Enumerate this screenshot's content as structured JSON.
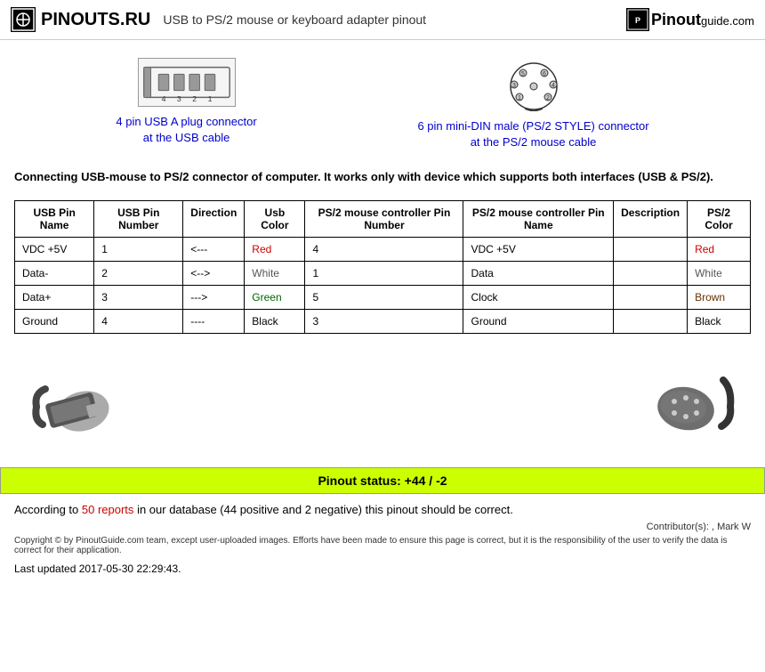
{
  "header": {
    "site_name": "PINOUTS.RU",
    "page_title": "USB to PS/2 mouse or keyboard adapter pinout",
    "guide_name": "Pinout",
    "guide_suffix": "guide.com"
  },
  "connectors": [
    {
      "id": "usb",
      "link_text": "4 pin USB A plug connector\nat the USB cable"
    },
    {
      "id": "ps2",
      "link_text": "6 pin mini-DIN male (PS/2 STYLE) connector\nat the PS/2 mouse cable"
    }
  ],
  "description": "Connecting USB-mouse to PS/2 connector of computer. It works only with device which supports both interfaces (USB & PS/2).",
  "table": {
    "headers": [
      "USB Pin Name",
      "USB Pin Number",
      "Direction",
      "Usb Color",
      "PS/2 mouse controller Pin Number",
      "PS/2 mouse controller Pin Name",
      "Description",
      "PS/2 Color"
    ],
    "rows": [
      {
        "usb_pin_name": "VDC +5V",
        "usb_pin_num": "1",
        "direction": "<---",
        "usb_color": "Red",
        "ps2_pin_num": "4",
        "ps2_pin_name": "VDC +5V",
        "description": "",
        "ps2_color": "Red"
      },
      {
        "usb_pin_name": "Data-",
        "usb_pin_num": "2",
        "direction": "<-->",
        "usb_color": "White",
        "ps2_pin_num": "1",
        "ps2_pin_name": "Data",
        "description": "",
        "ps2_color": "White"
      },
      {
        "usb_pin_name": "Data+",
        "usb_pin_num": "3",
        "direction": "--->",
        "usb_color": "Green",
        "ps2_pin_num": "5",
        "ps2_pin_name": "Clock",
        "description": "",
        "ps2_color": "Brown"
      },
      {
        "usb_pin_name": "Ground",
        "usb_pin_num": "4",
        "direction": "----",
        "usb_color": "Black",
        "ps2_pin_num": "3",
        "ps2_pin_name": "Ground",
        "description": "",
        "ps2_color": "Black"
      }
    ]
  },
  "status": {
    "label": "Pinout status: +44 / -2"
  },
  "footer": {
    "reports_count": "50 reports",
    "footer_text": "According to",
    "footer_mid": "in our database (44 positive and 2 negative) this pinout should be correct.",
    "contributor": "Contributor(s):  , Mark W",
    "copyright": "Copyright © by PinoutGuide.com team, except user-uploaded images. Efforts have been made to ensure this page is correct, but it is the responsibility of the user to verify the data is correct for their application.",
    "updated": "Last updated 2017-05-30 22:29:43."
  }
}
